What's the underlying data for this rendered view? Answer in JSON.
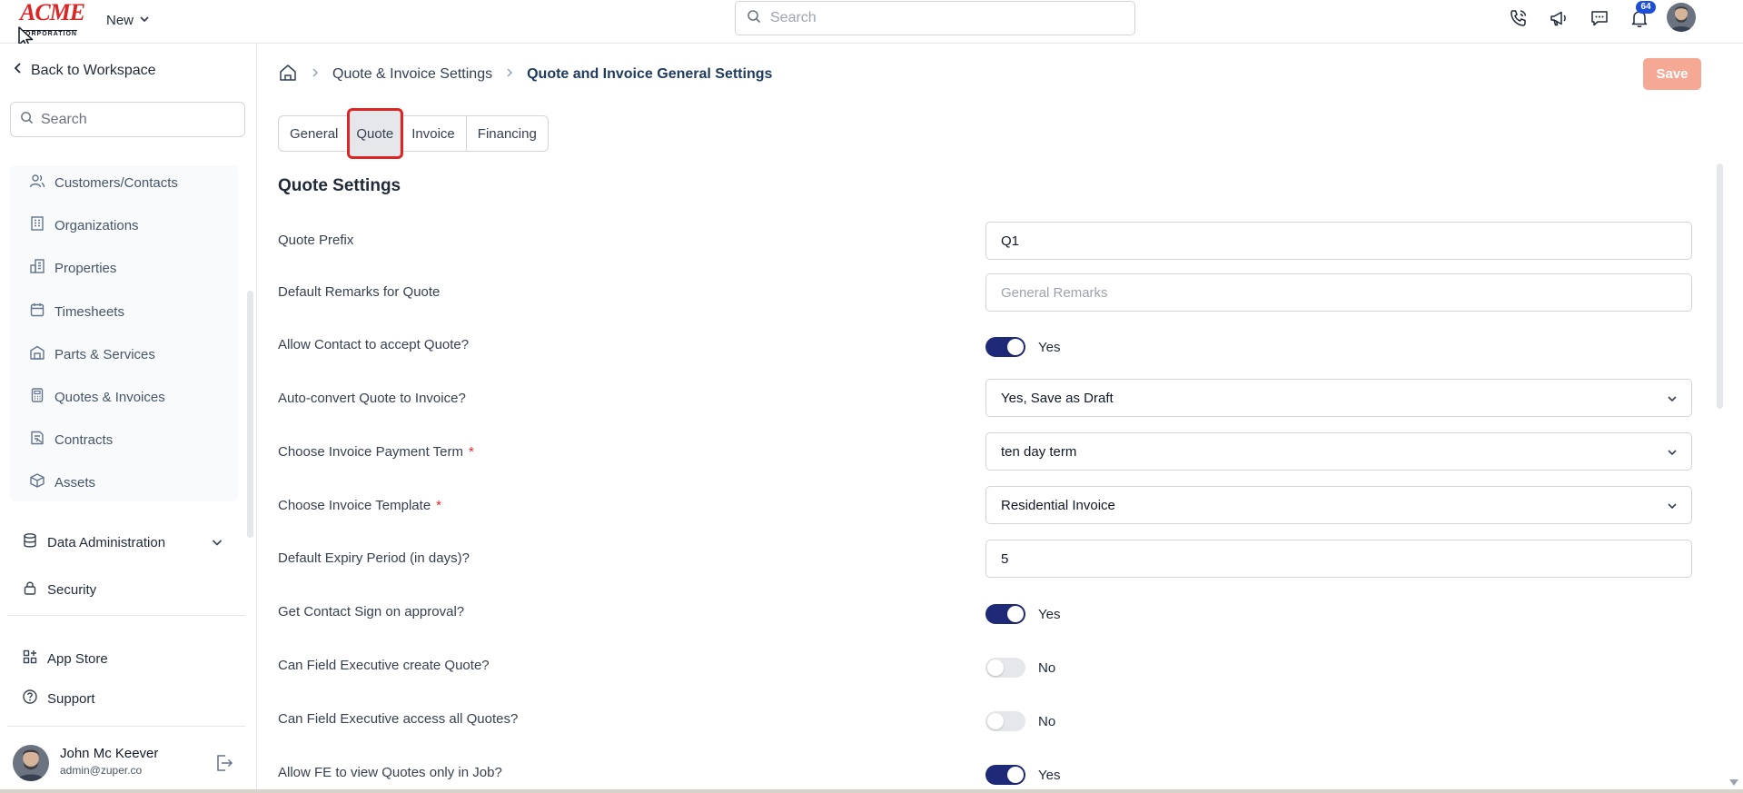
{
  "app": {
    "logo_text": "ACME",
    "logo_subtext": "CORPORATION",
    "new_label": "New",
    "search_placeholder": "Search",
    "notification_count": "64"
  },
  "sidebar": {
    "back_label": "Back to Workspace",
    "search_placeholder": "Search",
    "nav_items": [
      {
        "label": "Customers/Contacts",
        "icon": "users-icon"
      },
      {
        "label": "Organizations",
        "icon": "building-icon"
      },
      {
        "label": "Properties",
        "icon": "property-icon"
      },
      {
        "label": "Timesheets",
        "icon": "calendar-icon"
      },
      {
        "label": "Parts & Services",
        "icon": "warehouse-icon"
      },
      {
        "label": "Quotes & Invoices",
        "icon": "calculator-icon"
      },
      {
        "label": "Contracts",
        "icon": "contract-icon"
      },
      {
        "label": "Assets",
        "icon": "box-icon"
      }
    ],
    "data_admin_label": "Data Administration",
    "security_label": "Security",
    "app_store_label": "App Store",
    "support_label": "Support",
    "user": {
      "name": "John Mc Keever",
      "email": "admin@zuper.co"
    }
  },
  "main": {
    "breadcrumb": {
      "parent": "Quote & Invoice Settings",
      "current": "Quote and Invoice General Settings"
    },
    "save_label": "Save",
    "tabs": [
      {
        "label": "General",
        "active": false
      },
      {
        "label": "Quote",
        "active": true
      },
      {
        "label": "Invoice",
        "active": false
      },
      {
        "label": "Financing",
        "active": false
      }
    ],
    "section_title": "Quote Settings",
    "settings": {
      "quote_prefix": {
        "label": "Quote Prefix",
        "value": "Q1"
      },
      "default_remarks": {
        "label": "Default Remarks for Quote",
        "placeholder": "General Remarks"
      },
      "allow_accept": {
        "label": "Allow Contact to accept Quote?",
        "state": "Yes",
        "on": true
      },
      "auto_convert": {
        "label": "Auto-convert Quote to Invoice?",
        "value": "Yes, Save as Draft"
      },
      "payment_term": {
        "label": "Choose Invoice Payment Term",
        "value": "ten day term",
        "required": "*"
      },
      "invoice_template": {
        "label": "Choose Invoice Template",
        "value": "Residential Invoice",
        "required": "*"
      },
      "expiry_period": {
        "label": "Default Expiry Period (in days)?",
        "value": "5"
      },
      "contact_sign": {
        "label": "Get Contact Sign on approval?",
        "state": "Yes",
        "on": true
      },
      "fe_create": {
        "label": "Can Field Executive create Quote?",
        "state": "No",
        "on": false
      },
      "fe_access_all": {
        "label": "Can Field Executive access all Quotes?",
        "state": "No",
        "on": false
      },
      "fe_view_job": {
        "label": "Allow FE to view Quotes only in Job?",
        "state": "Yes",
        "on": true
      }
    }
  },
  "colors": {
    "accent": "#1e2a78",
    "save_button": "#f5a894",
    "highlight": "#dc2626",
    "badge": "#1d4ed8"
  }
}
